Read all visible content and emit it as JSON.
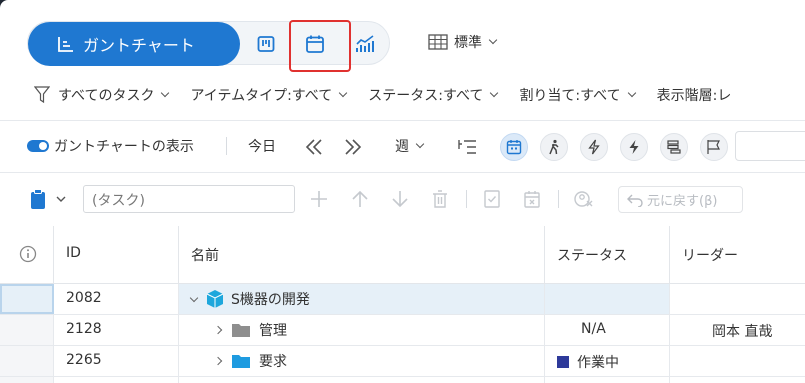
{
  "header": {
    "gantt_view_label": "ガントチャート",
    "views": [
      {
        "icon": "board-icon"
      },
      {
        "icon": "calendar-icon"
      },
      {
        "icon": "analytics-icon"
      }
    ],
    "view_mode_label": "標準"
  },
  "filters": [
    {
      "label": "すべてのタスク"
    },
    {
      "label": "アイテムタイプ:すべて"
    },
    {
      "label": "ステータス:すべて"
    },
    {
      "label": "割り当て:すべて"
    },
    {
      "label": "表示階層:レ"
    }
  ],
  "toolbar": {
    "show_gantt_label": "ガントチャートの表示",
    "today_label": "今日",
    "period_label": "週"
  },
  "task_toolbar": {
    "task_placeholder": "(タスク)",
    "undo_label": "元に戻す(β)"
  },
  "grid": {
    "columns": [
      "ID",
      "名前",
      "ステータス",
      "リーダー"
    ],
    "rows": [
      {
        "id": "2082",
        "name": "S機器の開発",
        "status": "",
        "leader": "",
        "icon": "cube-icon",
        "expanded": true
      },
      {
        "id": "2128",
        "name": "管理",
        "status": "N/A",
        "leader": "岡本 直哉",
        "icon": "folder-icon",
        "expanded": false
      },
      {
        "id": "2265",
        "name": "要求",
        "status": "作業中",
        "leader": "",
        "icon": "folder-icon",
        "expanded": false
      }
    ]
  },
  "colors": {
    "accent": "#1f78d1",
    "highlight_border": "#e0312f",
    "status_in_progress": "#2e3a9a",
    "cube": "#1ea7dc",
    "folder_gray": "#8e8e8e",
    "folder_blue": "#1e9be0"
  }
}
